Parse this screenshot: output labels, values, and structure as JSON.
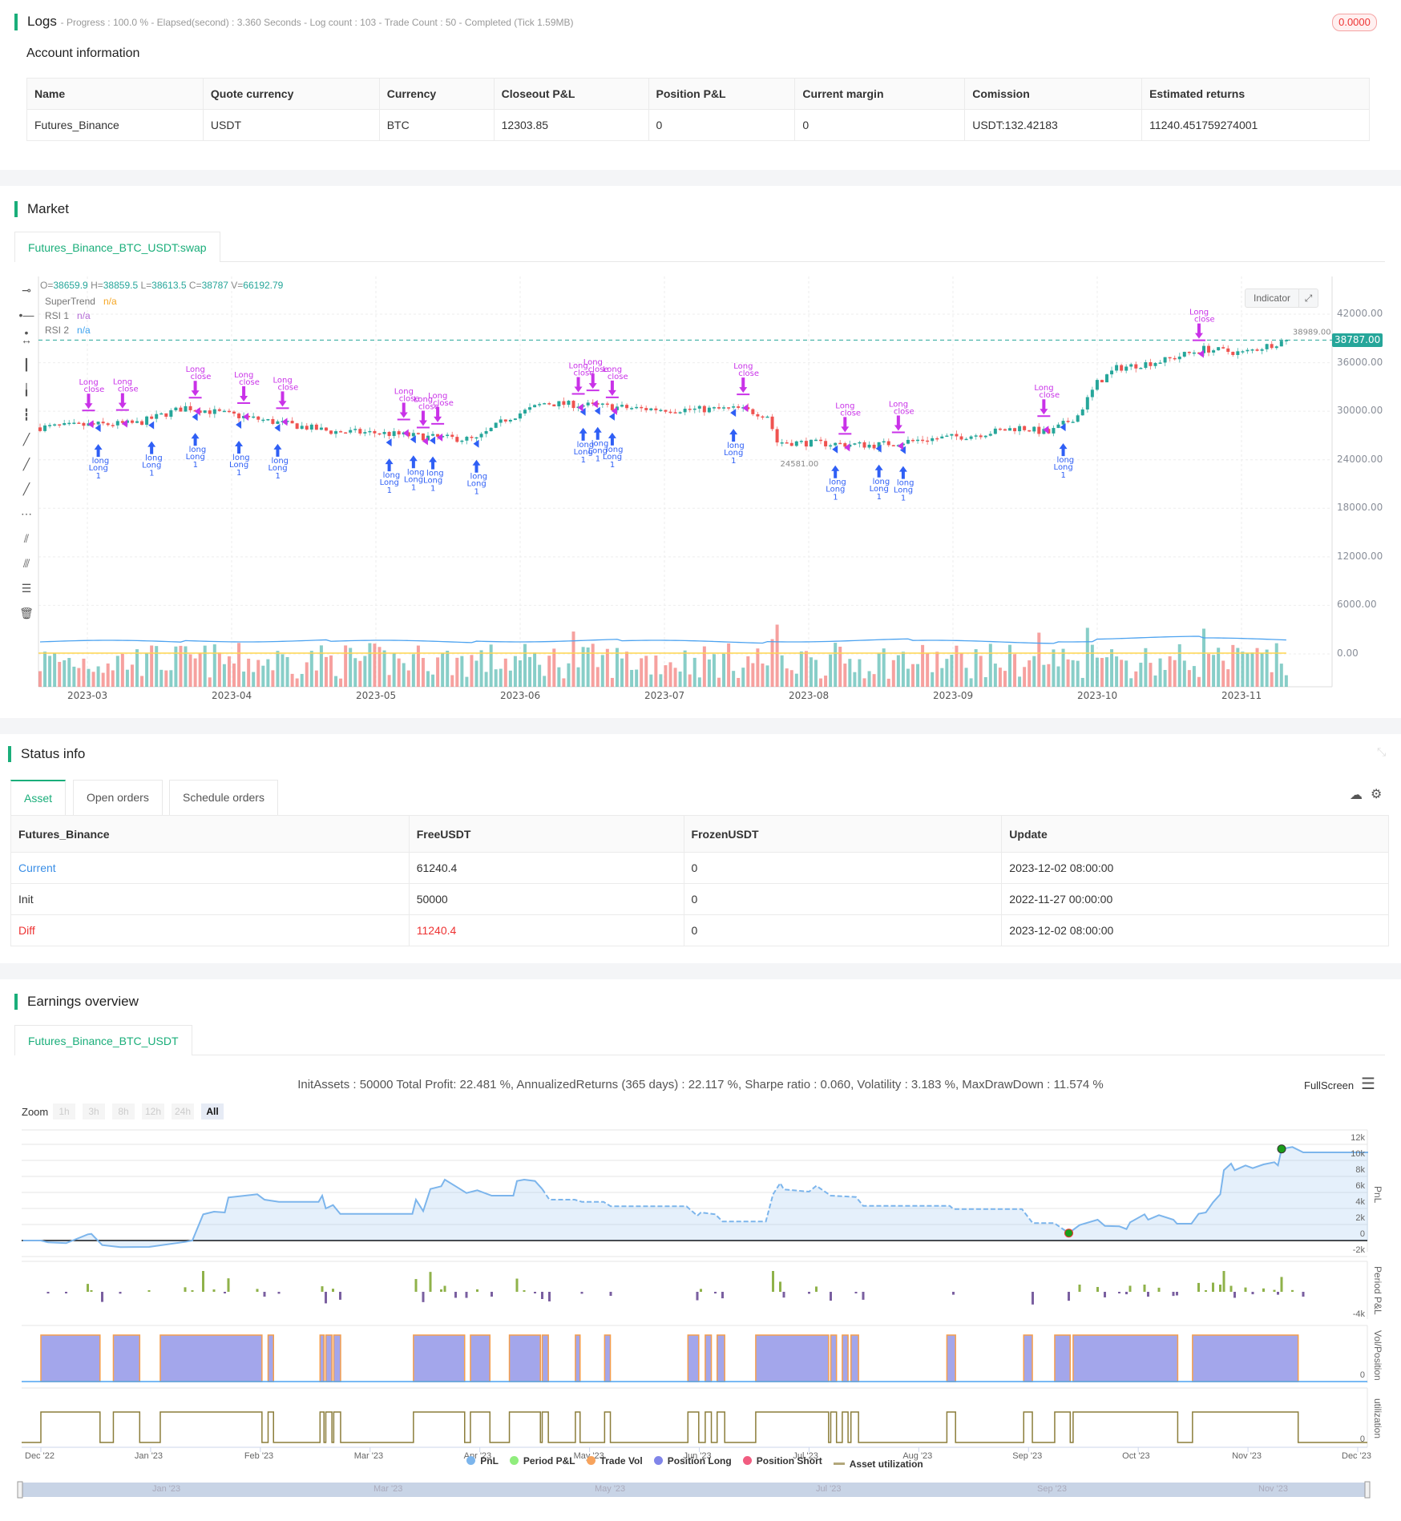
{
  "logs": {
    "title": "Logs",
    "summary": "- Progress : 100.0 % - Elapsed(second) : 3.360  Seconds - Log count : 103 - Trade Count : 50 - Completed (Tick 1.59MB)",
    "badge": "0.0000"
  },
  "account": {
    "title": "Account information",
    "headers": [
      "Name",
      "Quote currency",
      "Currency",
      "Closeout P&L",
      "Position P&L",
      "Current margin",
      "Comission",
      "Estimated returns"
    ],
    "row": [
      "Futures_Binance",
      "USDT",
      "BTC",
      "12303.85",
      "0",
      "0",
      "USDT:132.42183",
      "11240.451759274001"
    ]
  },
  "market": {
    "title": "Market",
    "tab": "Futures_Binance_BTC_USDT:swap",
    "ohlc": {
      "o_label": "O=",
      "o": "38659.9",
      "h_label": " H=",
      "h": "38859.5",
      "l_label": " L=",
      "l": "38613.5",
      "c_label": " C=",
      "c": "38787",
      "v_label": " V=",
      "v": "66192.79"
    },
    "indicators": [
      {
        "name": "SuperTrend",
        "value": "n/a",
        "color": "#f5a623"
      },
      {
        "name": "RSI 1",
        "value": "n/a",
        "color": "#b36bd6"
      },
      {
        "name": "RSI 2",
        "value": "n/a",
        "color": "#3ba1ef"
      }
    ],
    "indicator_button": "Indicator",
    "y_ticks": [
      "42000.00",
      "36000.00",
      "30000.00",
      "24000.00",
      "18000.00",
      "12000.00",
      "6000.00",
      "0.00"
    ],
    "x_ticks": [
      "2023-03",
      "2023-04",
      "2023-05",
      "2023-06",
      "2023-07",
      "2023-08",
      "2023-09",
      "2023-10",
      "2023-11"
    ],
    "last_price": "38787.00",
    "last_price_value": 38787,
    "high_mark": "38989.00",
    "low_mark": "24581.00",
    "price_path": [
      [
        0,
        28
      ],
      [
        10,
        28.3
      ],
      [
        20,
        28.5
      ],
      [
        30,
        30.5
      ],
      [
        40,
        29.5
      ],
      [
        50,
        28.5
      ],
      [
        60,
        27.5
      ],
      [
        70,
        27.3
      ],
      [
        80,
        26.8
      ],
      [
        90,
        26.5
      ],
      [
        96,
        29
      ],
      [
        104,
        31
      ],
      [
        114,
        30.7
      ],
      [
        124,
        30.3
      ],
      [
        134,
        30.2
      ],
      [
        144,
        30.3
      ],
      [
        150,
        29.5
      ],
      [
        152,
        26.2
      ],
      [
        162,
        26
      ],
      [
        172,
        25.8
      ],
      [
        182,
        26.5
      ],
      [
        192,
        27
      ],
      [
        202,
        28
      ],
      [
        208,
        27.3
      ],
      [
        214,
        29.5
      ],
      [
        218,
        33.5
      ],
      [
        222,
        35.3
      ],
      [
        232,
        36.3
      ],
      [
        240,
        37.7
      ],
      [
        248,
        37.2
      ],
      [
        257,
        38.8
      ]
    ],
    "markers": {
      "entries": [
        {
          "i": 12,
          "label": "Long",
          "sub": "long",
          "n": "1"
        },
        {
          "i": 23,
          "label": "Long",
          "sub": "long",
          "n": "1"
        },
        {
          "i": 32,
          "label": "Long",
          "sub": "long",
          "n": "1"
        },
        {
          "i": 41,
          "label": "Long",
          "sub": "long",
          "n": "1"
        },
        {
          "i": 49,
          "label": "Long",
          "sub": "long",
          "n": "1"
        },
        {
          "i": 72,
          "label": "Long",
          "sub": "long",
          "n": "1"
        },
        {
          "i": 77,
          "label": "Long",
          "sub": "long",
          "n": "1"
        },
        {
          "i": 81,
          "label": "Long",
          "sub": "long",
          "n": "1"
        },
        {
          "i": 90,
          "label": "Long",
          "sub": "long",
          "n": "1"
        },
        {
          "i": 112,
          "label": "Long",
          "sub": "long",
          "n": "1"
        },
        {
          "i": 115,
          "label": "Long",
          "sub": "long",
          "n": "1"
        },
        {
          "i": 118,
          "label": "Long",
          "sub": "long",
          "n": "1"
        },
        {
          "i": 143,
          "label": "Long",
          "sub": "long",
          "n": "1"
        },
        {
          "i": 164,
          "label": "Long",
          "sub": "long",
          "n": "1"
        },
        {
          "i": 173,
          "label": "Long",
          "sub": "long",
          "n": "1"
        },
        {
          "i": 178,
          "label": "Long",
          "sub": "long",
          "n": "1"
        },
        {
          "i": 211,
          "label": "Long",
          "sub": "long",
          "n": "1"
        }
      ],
      "exits": [
        {
          "i": 10,
          "label": "Long",
          "sub": "close"
        },
        {
          "i": 17,
          "label": "Long",
          "sub": "close"
        },
        {
          "i": 32,
          "label": "Long",
          "sub": "close"
        },
        {
          "i": 42,
          "label": "Long",
          "sub": "close"
        },
        {
          "i": 50,
          "label": "Long",
          "sub": "close"
        },
        {
          "i": 75,
          "label": "Long",
          "sub": "close"
        },
        {
          "i": 79,
          "label": "Long",
          "sub": "close"
        },
        {
          "i": 82,
          "label": "Long",
          "sub": "close"
        },
        {
          "i": 111,
          "label": "Long",
          "sub": "close"
        },
        {
          "i": 114,
          "label": "Long",
          "sub": "close"
        },
        {
          "i": 118,
          "label": "Long",
          "sub": "close"
        },
        {
          "i": 145,
          "label": "Long",
          "sub": "close"
        },
        {
          "i": 166,
          "label": "Long",
          "sub": "close"
        },
        {
          "i": 177,
          "label": "Long",
          "sub": "close"
        },
        {
          "i": 207,
          "label": "Long",
          "sub": "close"
        },
        {
          "i": 239,
          "label": "Long",
          "sub": "close"
        }
      ]
    },
    "colors": {
      "up": "#26a69a",
      "down": "#ef5350",
      "entry": "#2f5ff5",
      "exit": "#c932e8"
    }
  },
  "status": {
    "title": "Status info",
    "tabs": [
      "Asset",
      "Open orders",
      "Schedule orders"
    ],
    "headers": [
      "Futures_Binance",
      "FreeUSDT",
      "FrozenUSDT",
      "Update"
    ],
    "rows": [
      [
        "Current",
        "61240.4",
        "0",
        "2023-12-02 08:00:00"
      ],
      [
        "Init",
        "50000",
        "0",
        "2022-11-27 00:00:00"
      ],
      [
        "Diff",
        "11240.4",
        "0",
        "2023-12-02 08:00:00"
      ]
    ]
  },
  "earnings": {
    "title": "Earnings overview",
    "tab": "Futures_Binance_BTC_USDT",
    "stats": "InitAssets : 50000 Total Profit: 22.481 %, AnnualizedReturns (365 days) : 22.117 %, Sharpe ratio : 0.060, Volatility : 3.183 %, MaxDrawDown : 11.574 %",
    "fullscreen": "FullScreen",
    "zoom_label": "Zoom",
    "zoom_buttons": [
      "1h",
      "3h",
      "8h",
      "12h",
      "24h",
      "All"
    ],
    "pnl_ticks": [
      "12k",
      "10k",
      "8k",
      "6k",
      "4k",
      "2k",
      "0",
      "-2k"
    ],
    "period_tick": "-4k",
    "pos_tick": "0",
    "util_tick": "0",
    "panel_labels": [
      "PnL",
      "Period P&L",
      "Vol/Position",
      "utilization"
    ],
    "x_ticks": [
      "Dec '22",
      "Jan '23",
      "Feb '23",
      "Mar '23",
      "Apr '23",
      "May '23",
      "Jun '23",
      "Jul '23",
      "Aug '23",
      "Sep '23",
      "Oct '23",
      "Nov '23",
      "Dec '23"
    ],
    "nav_ticks": [
      "Jan '23",
      "Mar '23",
      "May '23",
      "Jul '23",
      "Sep '23",
      "Nov '23"
    ],
    "legend": [
      {
        "label": "PnL",
        "color": "#7cb5ec"
      },
      {
        "label": "Period P&L",
        "color": "#90ed7d"
      },
      {
        "label": "Trade Vol",
        "color": "#f7a35c"
      },
      {
        "label": "Position Long",
        "color": "#8085e9"
      },
      {
        "label": "Position Short",
        "color": "#f15c80"
      },
      {
        "label": "Asset utilization",
        "color": "#b2a77a"
      }
    ],
    "chart_data": {
      "type": "line",
      "x_unit": "days since 2022-12-01",
      "y_unit": "USDT thousands",
      "pnl": [
        [
          -5,
          0
        ],
        [
          0,
          0
        ],
        [
          2,
          -0.23
        ],
        [
          7,
          -0.33
        ],
        [
          13,
          0.77
        ],
        [
          14,
          0.83
        ],
        [
          17,
          -0.57
        ],
        [
          22,
          -0.83
        ],
        [
          30,
          -0.8
        ],
        [
          40,
          -0.17
        ],
        [
          42,
          0
        ],
        [
          45,
          3.27
        ],
        [
          48,
          3.6
        ],
        [
          51,
          3.5
        ],
        [
          52,
          5.37
        ],
        [
          60,
          5.77
        ],
        [
          62,
          5.1
        ],
        [
          66,
          4.83
        ],
        [
          77,
          4.83
        ],
        [
          78,
          5.6
        ],
        [
          79,
          4
        ],
        [
          81,
          4.43
        ],
        [
          83,
          3.33
        ],
        [
          103,
          3.33
        ],
        [
          104,
          5.1
        ],
        [
          106,
          3.67
        ],
        [
          108,
          6.43
        ],
        [
          111,
          6.77
        ],
        [
          112,
          7.6
        ],
        [
          115,
          6.77
        ],
        [
          118,
          5.93
        ],
        [
          121,
          6.27
        ],
        [
          125,
          5.6
        ],
        [
          131,
          5.6
        ],
        [
          132,
          7.43
        ],
        [
          134,
          7.6
        ],
        [
          137,
          7.43
        ],
        [
          139,
          6.43
        ],
        [
          141,
          5.1
        ],
        [
          148,
          5.1
        ],
        [
          150,
          4.83
        ],
        [
          156,
          4.83
        ],
        [
          158,
          4.27
        ],
        [
          179,
          4.27
        ],
        [
          182,
          3.1
        ],
        [
          183,
          3.5
        ],
        [
          187,
          3.27
        ],
        [
          189,
          2.37
        ],
        [
          201,
          2.37
        ],
        [
          203,
          5.77
        ],
        [
          205,
          7.17
        ],
        [
          206,
          6.37
        ],
        [
          213,
          6.1
        ],
        [
          215,
          6.83
        ],
        [
          219,
          5.6
        ],
        [
          226,
          5.43
        ],
        [
          228,
          4.33
        ],
        [
          252,
          4.33
        ],
        [
          253,
          3.93
        ],
        [
          272,
          3.93
        ],
        [
          275,
          2.17
        ],
        [
          281,
          2.17
        ],
        [
          285,
          0.93
        ],
        [
          288,
          1.93
        ],
        [
          293,
          2.6
        ],
        [
          295,
          1.83
        ],
        [
          299,
          1.77
        ],
        [
          301,
          1.43
        ],
        [
          302,
          2.27
        ],
        [
          306,
          3.27
        ],
        [
          307,
          2.6
        ],
        [
          310,
          3.17
        ],
        [
          314,
          2.6
        ],
        [
          315,
          2.1
        ],
        [
          319,
          2.1
        ],
        [
          321,
          3.33
        ],
        [
          323,
          3.5
        ],
        [
          325,
          4.77
        ],
        [
          327,
          5.77
        ],
        [
          328,
          8.77
        ],
        [
          330,
          9.6
        ],
        [
          331,
          8.77
        ],
        [
          334,
          9.37
        ],
        [
          336,
          9.03
        ],
        [
          339,
          9.5
        ],
        [
          342,
          9.77
        ],
        [
          343,
          9.37
        ],
        [
          344,
          11.43
        ],
        [
          347,
          11.67
        ],
        [
          350,
          11.0
        ],
        [
          368,
          11.0
        ]
      ],
      "dashed_range": [
        139,
        285
      ],
      "max_day": 344,
      "min_day": 285,
      "positions": [
        [
          0,
          16.4
        ],
        [
          20.1,
          27.4
        ],
        [
          33.1,
          61.3
        ],
        [
          63,
          64.5
        ],
        [
          77.4,
          78.5
        ],
        [
          79,
          80.7
        ],
        [
          81.2,
          83.1
        ],
        [
          103.3,
          117.5
        ],
        [
          119.1,
          124.5
        ],
        [
          129.9,
          138.5
        ],
        [
          139,
          140.7
        ],
        [
          148.2,
          149.5
        ],
        [
          156.3,
          157.9
        ],
        [
          179.4,
          182.4
        ],
        [
          184.2,
          185.9
        ],
        [
          187.5,
          189.6
        ],
        [
          198.2,
          218.4
        ],
        [
          219,
          220.6
        ],
        [
          222.2,
          223.8
        ],
        [
          224.6,
          226.7
        ],
        [
          251.2,
          253.6
        ],
        [
          272.5,
          274.9
        ],
        [
          281.1,
          285.4
        ],
        [
          286.2,
          315.2
        ],
        [
          319.3,
          348.6
        ]
      ]
    }
  }
}
